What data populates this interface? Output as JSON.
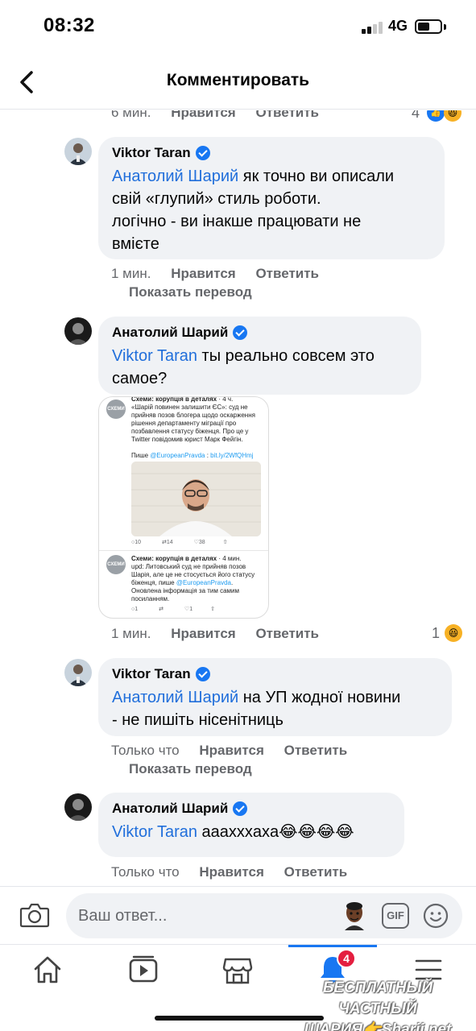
{
  "status_bar": {
    "time": "08:32",
    "network": "4G"
  },
  "header": {
    "title": "Комментировать"
  },
  "comments": [
    {
      "meta_time": "6 мин.",
      "like_label": "Нравится",
      "reply_label": "Ответить",
      "reaction_count": "4"
    },
    {
      "author": "Viktor Taran",
      "mention": "Анатолий Шарий",
      "text_line1": " як точно ви описали",
      "text_line2": "свій «глупий» стиль роботи.",
      "text_line3": "логічно - ви інакше працювати не",
      "text_line4": "вмієте",
      "time": "1 мин.",
      "like_label": "Нравится",
      "reply_label": "Ответить",
      "translate": "Показать перевод"
    },
    {
      "author": "Анатолий Шарий",
      "mention": "Viktor Taran",
      "text_line1": " ты реально совсем это",
      "text_line2": "самое?",
      "time": "1 мин.",
      "like_label": "Нравится",
      "reply_label": "Ответить",
      "reaction_count": "1",
      "attachment": {
        "header": "Схеми: корупція в деталях",
        "header_time": "· 4 ч.",
        "body1": "«Шарій повинен залишити ЄС»: суд не прийняв позов блогера щодо оскарження рішення департаменту міграції про позбавлення статусу біженця. Про це у Twitter повідомив юрист Марк Фейгін.",
        "body2_prefix": "Пише ",
        "body2_link1": "@EuropeanPravda",
        "body2_sep": " : ",
        "body2_link2": "bit.ly/2WfQHmj",
        "counts1": [
          "10",
          "14",
          "38"
        ],
        "header2": "Схеми: корупція в деталях",
        "header2_time": "· 4 мин.",
        "body3": "upd: Литовський суд не прийняв позов Шарія, але це не стосується його статусу біженця, пише ",
        "body3_link": "@EuropeanPravda",
        "body3_suffix": ". Оновлена інформація за тим самим посиланням.",
        "counts2": [
          "1",
          "1"
        ],
        "logo_text": "СХЕМИ"
      }
    },
    {
      "author": "Viktor Taran",
      "mention": "Анатолий Шарий",
      "text_line1": " на УП жодної новини",
      "text_line2": "- не пишіть нісенітниць",
      "time": "Только что",
      "like_label": "Нравится",
      "reply_label": "Ответить",
      "translate": "Показать перевод"
    },
    {
      "author": "Анатолий Шарий",
      "mention": "Viktor Taran",
      "text_line1": " аааxxxaxa😂😂😂😂",
      "time": "Только что",
      "like_label": "Нравится",
      "reply_label": "Ответить"
    }
  ],
  "composer": {
    "placeholder": "Ваш ответ...",
    "gif_label": "GIF"
  },
  "tabbar": {
    "notifications_badge": "4"
  },
  "watermark": {
    "line1": "БЕСПЛАТНЫЙ ЧАСТНЫЙ",
    "line2": "ШАРИЯ👉Sharij.net"
  },
  "colors": {
    "link_blue": "#216fdb",
    "fb_blue": "#1877f2",
    "bubble_bg": "#f0f2f5",
    "meta_gray": "#65676b",
    "badge_red": "#e41e3f"
  }
}
